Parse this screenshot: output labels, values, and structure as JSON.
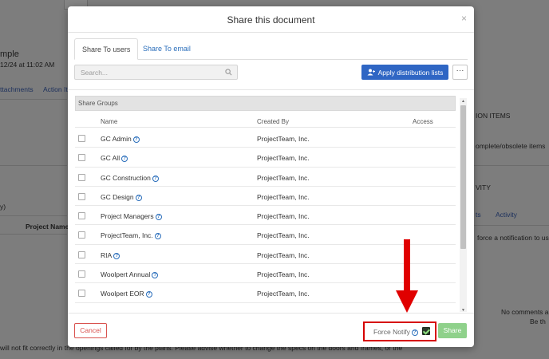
{
  "background": {
    "left_fragments": [
      "mple",
      "12/24 at 11:02 AM",
      "ttachments",
      "Action It",
      "y)",
      "Project Name"
    ],
    "right_fragments": [
      "ION ITEMS",
      "omplete/obsolete items",
      "VITY",
      "ts",
      "Activity",
      "force a notification to us",
      "No comments a",
      "Be th"
    ],
    "bottom_text": "will not fit correctly in the openings called for by the plans. Please advise whether to change the specs on the doors and frames, or the"
  },
  "modal": {
    "title": "Share this document",
    "close_glyph": "×",
    "tabs": [
      {
        "label": "Share To users",
        "active": true
      },
      {
        "label": "Share To email",
        "active": false
      }
    ],
    "search_placeholder": "Search...",
    "apply_button_label": "Apply distribution lists",
    "more_button_label": "···",
    "group_header": "Share Groups",
    "columns": {
      "name": "Name",
      "created_by": "Created By",
      "access": "Access"
    },
    "rows": [
      {
        "name": "GC Admin",
        "created_by": "ProjectTeam, Inc."
      },
      {
        "name": "GC All",
        "created_by": "ProjectTeam, Inc."
      },
      {
        "name": "GC Construction",
        "created_by": "ProjectTeam, Inc."
      },
      {
        "name": "GC Design",
        "created_by": "ProjectTeam, Inc."
      },
      {
        "name": "Project Managers",
        "created_by": "ProjectTeam, Inc."
      },
      {
        "name": "ProjectTeam, Inc.",
        "created_by": "ProjectTeam, Inc."
      },
      {
        "name": "RIA",
        "created_by": "ProjectTeam, Inc."
      },
      {
        "name": "Woolpert Annual",
        "created_by": "ProjectTeam, Inc."
      },
      {
        "name": "Woolpert EOR",
        "created_by": "ProjectTeam, Inc."
      }
    ],
    "help_glyph": "?",
    "cancel_label": "Cancel",
    "force_notify_label": "Force Notify",
    "force_notify_checked": true,
    "share_label": "Share"
  },
  "colors": {
    "primary": "#2f66c4",
    "danger": "#d9534f",
    "success_disabled": "#8fd18b",
    "annotation_red": "#d60000"
  }
}
